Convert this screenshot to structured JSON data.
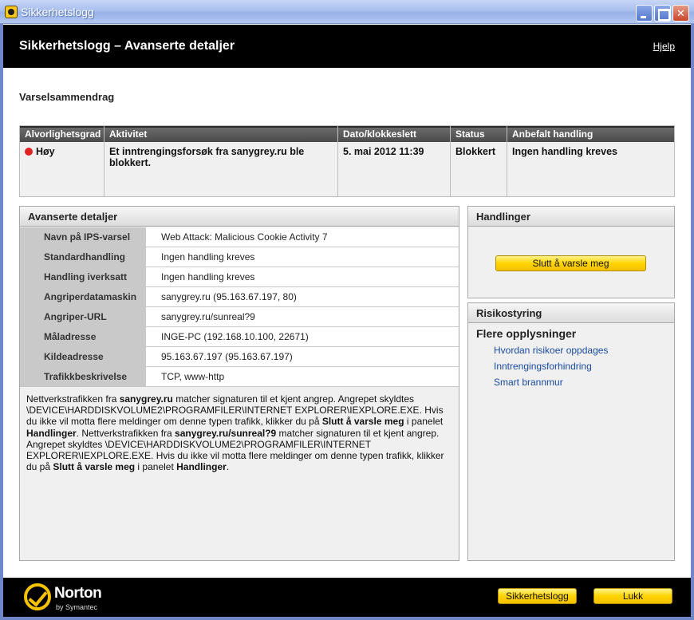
{
  "window": {
    "title": "Sikkerhetslogg"
  },
  "header": {
    "title": "Sikkerhetslogg – Avanserte detaljer",
    "help_label": "Hjelp"
  },
  "summary": {
    "title": "Varselsammendrag",
    "columns": [
      "Alvorlighetsgrad",
      "Aktivitet",
      "Dato/klokkeslett",
      "Status",
      "Anbefalt handling"
    ],
    "row": {
      "severity": "Høy",
      "activity": "Et inntrengingsforsøk fra sanygrey.ru ble blokkert.",
      "datetime": "5. mai 2012 11:39",
      "status": "Blokkert",
      "recommended_action": "Ingen handling kreves"
    }
  },
  "advanced": {
    "title": "Avanserte detaljer",
    "rows": [
      {
        "label": "Navn på IPS-varsel",
        "value": "Web Attack: Malicious Cookie Activity 7"
      },
      {
        "label": "Standardhandling",
        "value": "Ingen handling kreves"
      },
      {
        "label": "Handling iverksatt",
        "value": "Ingen handling kreves"
      },
      {
        "label": "Angriperdatamaskin",
        "value": "sanygrey.ru (95.163.67.197, 80)"
      },
      {
        "label": "Angriper-URL",
        "value": "sanygrey.ru/sunreal?9"
      },
      {
        "label": "Måladresse",
        "value": "INGE-PC (192.168.10.100, 22671)"
      },
      {
        "label": "Kildeadresse",
        "value": "95.163.67.197 (95.163.67.197)"
      },
      {
        "label": "Trafikkbeskrivelse",
        "value": "TCP, www-http"
      }
    ],
    "description": {
      "p1": "Nettverkstrafikken fra ",
      "b1": "sanygrey.ru",
      "p2": " matcher signaturen til et kjent angrep. Angrepet skyldtes \\DEVICE\\HARDDISKVOLUME2\\PROGRAMFILER\\INTERNET EXPLORER\\IEXPLORE.EXE. Hvis du ikke vil motta flere meldinger om denne typen trafikk, klikker du på ",
      "b2": "Slutt å varsle meg",
      "p3": " i panelet ",
      "b3": "Handlinger",
      "p4": ". Nettverkstrafikken fra ",
      "b4": "sanygrey.ru/sunreal?9",
      "p5": " matcher signaturen til et kjent angrep. Angrepet skyldtes \\DEVICE\\HARDDISKVOLUME2\\PROGRAMFILER\\INTERNET EXPLORER\\IEXPLORE.EXE. Hvis du ikke vil motta flere meldinger om denne typen trafikk, klikker du på ",
      "b5": "Slutt å varsle meg",
      "p6": " i panelet ",
      "b6": "Handlinger",
      "p7": "."
    }
  },
  "actions": {
    "title": "Handlinger",
    "stop_alert_label": "Slutt å varsle meg"
  },
  "risk": {
    "title": "Risikostyring",
    "subtitle": "Flere opplysninger",
    "links": [
      "Hvordan risikoer oppdages",
      "Inntrengingsforhindring",
      "Smart brannmur"
    ]
  },
  "footer": {
    "brand": "Norton",
    "byline": "by Symantec",
    "log_button": "Sikkerhetslogg",
    "close_button": "Lukk"
  },
  "colors": {
    "severity_high": "#e02424",
    "button_yellow": "#ffd400",
    "header_bg": "#000000",
    "link": "#1b4aa0"
  },
  "icons": {
    "app": "norton-app-icon",
    "severity": "red-dot-icon",
    "logo": "norton-checkmark-icon"
  }
}
